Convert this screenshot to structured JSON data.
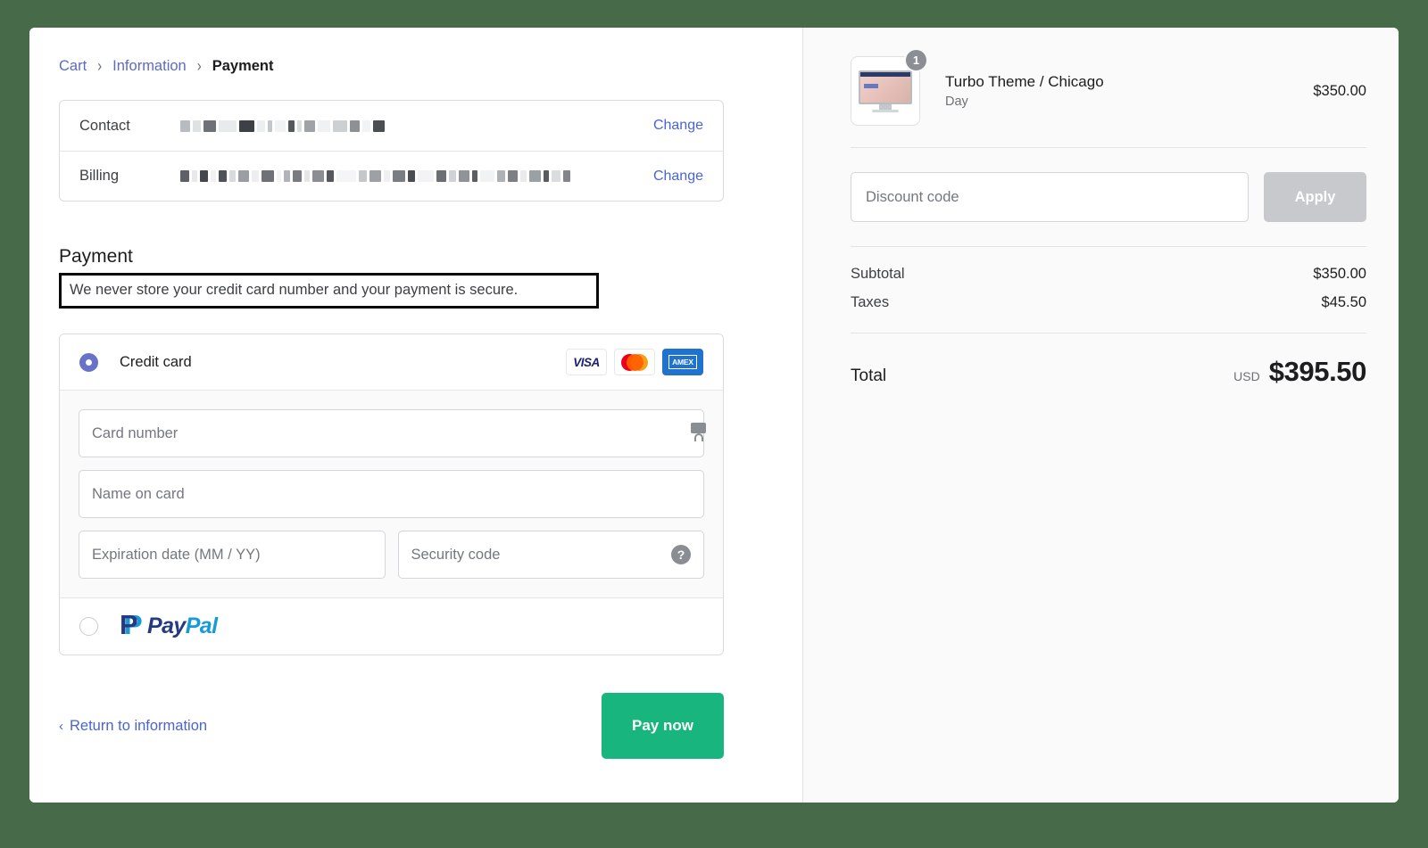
{
  "breadcrumb": {
    "cart": "Cart",
    "information": "Information",
    "payment": "Payment",
    "separator": "›"
  },
  "info_card": {
    "contact_label": "Contact",
    "contact_value": "",
    "billing_label": "Billing",
    "billing_value": "",
    "change_label_contact": "Change",
    "change_label_billing": "Change"
  },
  "payment_section": {
    "title": "Payment",
    "secure_note": "We never store your credit card number and your payment is secure."
  },
  "credit_card": {
    "label": "Credit card",
    "selected": true,
    "brands": [
      {
        "name": "visa-logo",
        "text": "VISA"
      },
      {
        "name": "mastercard-logo",
        "text": ""
      },
      {
        "name": "amex-logo",
        "text": "AMEX"
      }
    ],
    "fields": {
      "card_number_placeholder": "Card number",
      "name_on_card_placeholder": "Name on card",
      "expiration_placeholder": "Expiration date (MM / YY)",
      "security_code_placeholder": "Security code",
      "help_glyph": "?"
    }
  },
  "paypal": {
    "selected": false,
    "pay_text": "Pay",
    "pal_text": "Pal",
    "mark_glyph": "P"
  },
  "actions": {
    "return_label": "Return to information",
    "return_chevron": "‹",
    "pay_now_label": "Pay now"
  },
  "summary": {
    "item": {
      "title": "Turbo Theme / Chicago",
      "variant": "Day",
      "price": "$350.00",
      "quantity": "1"
    },
    "discount": {
      "placeholder": "Discount code",
      "value": "",
      "apply_label": "Apply"
    },
    "totals": [
      {
        "label": "Subtotal",
        "value": "$350.00"
      },
      {
        "label": "Taxes",
        "value": "$45.50"
      }
    ],
    "grand_total": {
      "label": "Total",
      "currency": "USD",
      "value": "$395.50"
    }
  },
  "colors": {
    "page_background": "#476b48",
    "accent_link": "#4a64d4",
    "radio_selected": "#6872c8",
    "pay_button": "#19b57f",
    "apply_button": "#c7c9cc",
    "summary_background": "#fafafa"
  }
}
